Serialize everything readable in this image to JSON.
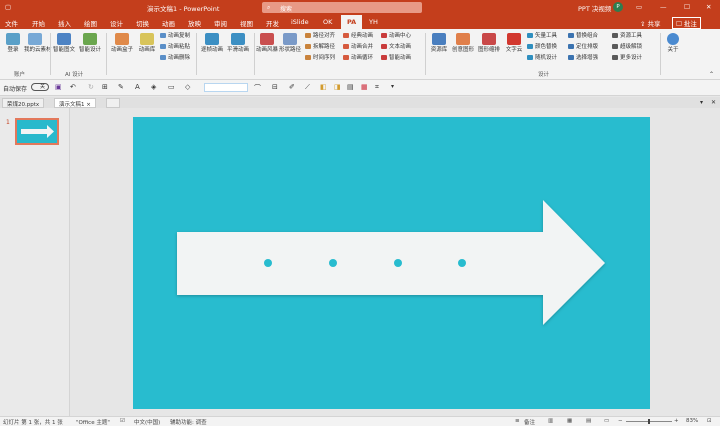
{
  "window": {
    "title": "演示文稿1 - PowerPoint",
    "search_placeholder": "搜索",
    "user_name": "PPT 决视频",
    "avatar_letter": "P"
  },
  "menu": {
    "tabs": [
      "文件",
      "开始",
      "插入",
      "绘图",
      "设计",
      "切换",
      "动画",
      "放映",
      "审阅",
      "视图",
      "开发",
      "iSlide",
      "OK",
      "PA",
      "YH"
    ],
    "active_tab": "PA",
    "share": "共享",
    "comments": "批注"
  },
  "ribbon": {
    "account_group": {
      "label": "账户",
      "buttons": [
        "登录",
        "我的云素材"
      ]
    },
    "ai_group": {
      "label": "AI 设计",
      "buttons": [
        "智能图文",
        "智能设计"
      ]
    },
    "anim_group": {
      "buttons": [
        "动画盒子",
        "动画库"
      ],
      "small": [
        "动画复制",
        "动画粘贴",
        "动画删除"
      ]
    },
    "anim_group2": {
      "buttons": [
        "逐帧动画",
        "平滑动画"
      ]
    },
    "anim_group3": {
      "buttons": [
        "动画风暴",
        "形状路径"
      ]
    },
    "anim_group4": {
      "small": [
        "路径对齐",
        "拆解路径",
        "时间序列",
        "经典动画",
        "动画合并",
        "动画循环",
        "动画中心",
        "文本动画",
        "智能动画"
      ]
    },
    "design_group": {
      "label": "设计",
      "buttons": [
        "资源库",
        "创意图形",
        "图形缩排",
        "文字云"
      ],
      "small": [
        "矢量工具",
        "颜色替换",
        "随机设计",
        "替换组合",
        "定位排版",
        "选择增强",
        "资源工具",
        "超级解锁",
        "更多设计"
      ]
    },
    "about": {
      "buttons": [
        "关于"
      ]
    }
  },
  "qat": {
    "autosave_label": "自动保存",
    "autosave_state": "关"
  },
  "doctabs": [
    "荣煤20.pptx",
    "演示文稿1"
  ],
  "thumbnails": [
    {
      "number": "1"
    }
  ],
  "slide": {
    "background": "#28bccf",
    "arrow_color": "#f2f4f4",
    "dot_color": "#28bccf",
    "dots": 4
  },
  "status": {
    "slide_info": "幻灯片 第 1 张，共 1 张",
    "theme": "\"Office 主题\"",
    "language": "中文(中国)",
    "accessibility": "辅助功能: 调查",
    "notes": "备注",
    "zoom": "83%"
  }
}
